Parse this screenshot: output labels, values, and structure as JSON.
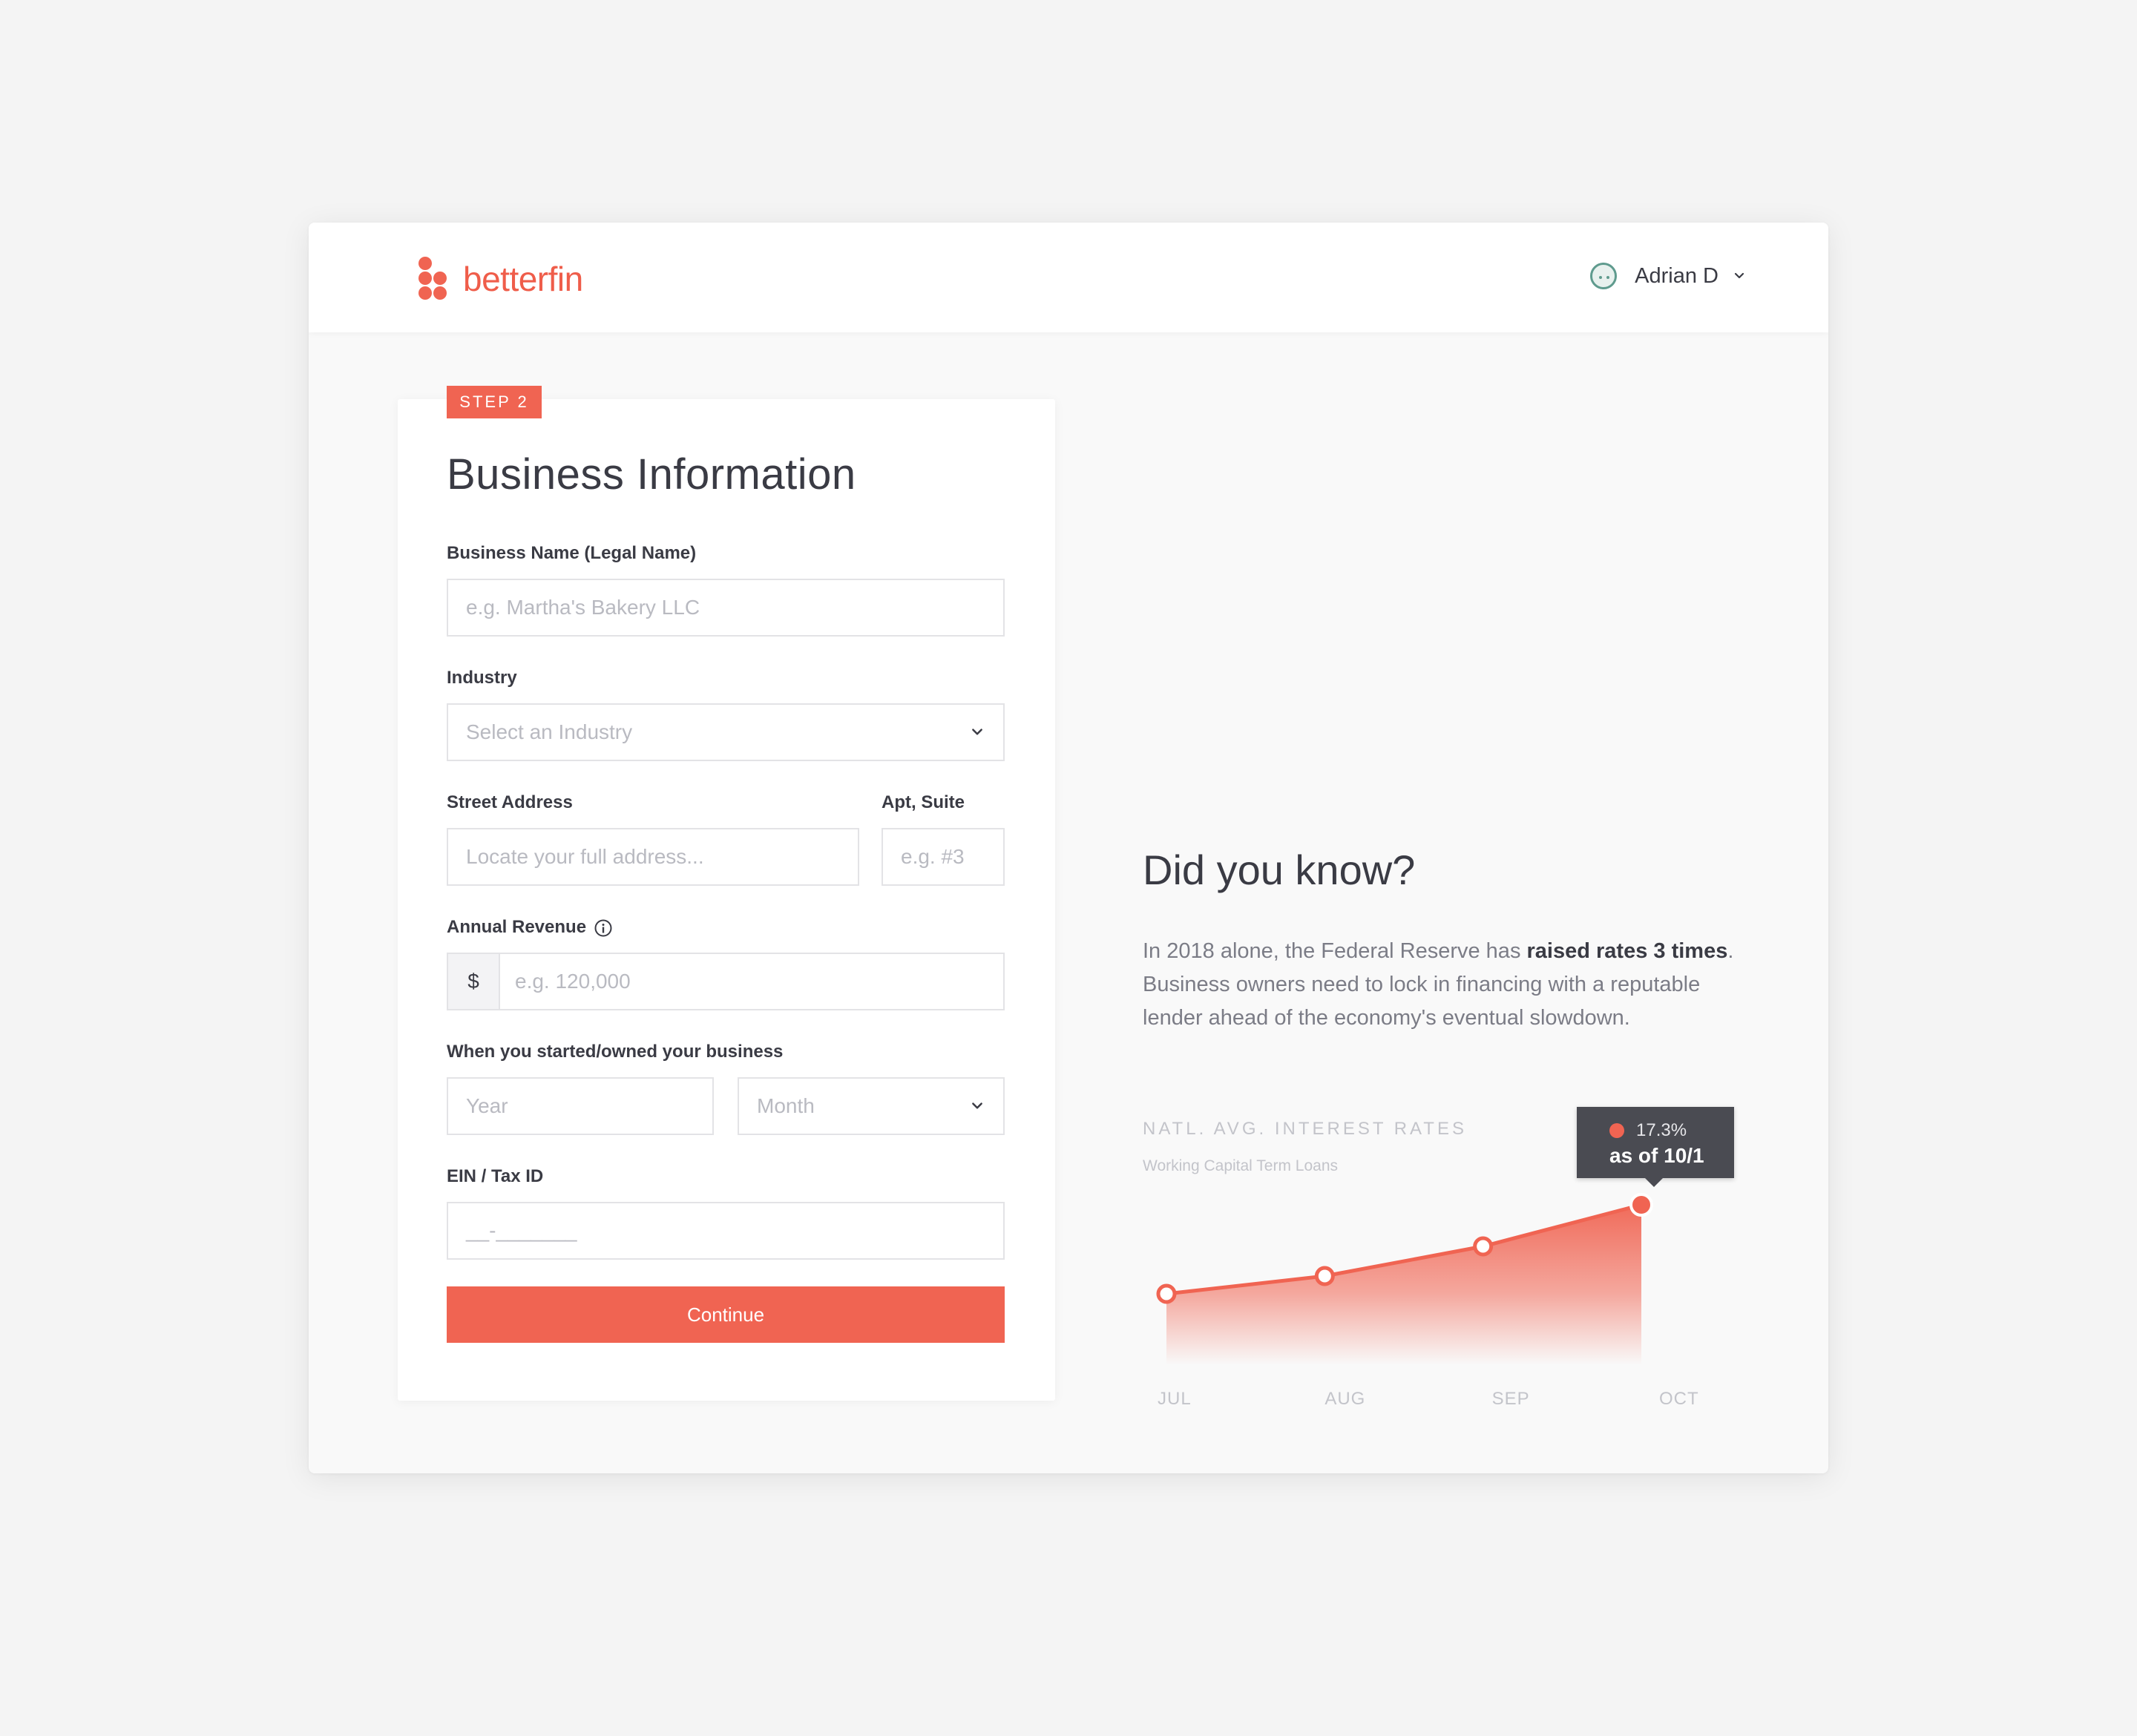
{
  "brand": {
    "name": "betterfin",
    "color": "#f06452"
  },
  "user": {
    "name": "Adrian D"
  },
  "form": {
    "step": "STEP 2",
    "title": "Business Information",
    "business_name": {
      "label": "Business Name (Legal Name)",
      "placeholder": "e.g. Martha's Bakery LLC"
    },
    "industry": {
      "label": "Industry",
      "placeholder": "Select an Industry"
    },
    "street": {
      "label": "Street Address",
      "placeholder": "Locate your full address..."
    },
    "apt": {
      "label": "Apt, Suite",
      "placeholder": "e.g. #3"
    },
    "revenue": {
      "label": "Annual Revenue",
      "prefix": "$",
      "placeholder": "e.g. 120,000"
    },
    "started": {
      "label": "When you started/owned your business",
      "year_placeholder": "Year",
      "month_placeholder": "Month"
    },
    "ein": {
      "label": "EIN / Tax ID",
      "placeholder": "__-_______"
    },
    "continue_label": "Continue"
  },
  "info": {
    "heading": "Did you know?",
    "text_before": "In 2018 alone, the Federal Reserve has ",
    "text_bold": "raised rates 3 times",
    "text_after": ". Business owners need to lock in financing with a reputable lender ahead of the economy's eventual slowdown."
  },
  "chart_data": {
    "type": "area",
    "title": "NATL. AVG. INTEREST RATES",
    "subtitle": "Working Capital Term Loans",
    "categories": [
      "JUL",
      "AUG",
      "SEP",
      "OCT"
    ],
    "values": [
      15.8,
      16.1,
      16.6,
      17.3
    ],
    "ylim": [
      14.6,
      17.6
    ],
    "tooltip": {
      "value": "17.3%",
      "date": "as of 10/1"
    },
    "color": "#f06452"
  }
}
